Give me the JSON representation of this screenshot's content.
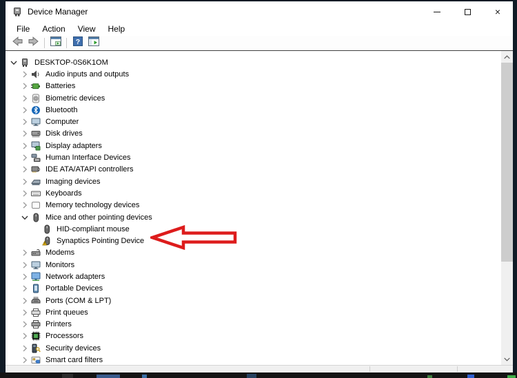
{
  "window": {
    "title": "Device Manager",
    "close_glyph": "×"
  },
  "menu": {
    "items": [
      "File",
      "Action",
      "View",
      "Help"
    ]
  },
  "toolbar": {
    "items": [
      {
        "type": "button",
        "name": "back"
      },
      {
        "type": "button",
        "name": "forward"
      },
      {
        "type": "separator"
      },
      {
        "type": "button",
        "name": "console-tree"
      },
      {
        "type": "separator"
      },
      {
        "type": "button",
        "name": "help"
      },
      {
        "type": "button",
        "name": "action-pane"
      }
    ]
  },
  "tree": {
    "items": [
      {
        "label": "DESKTOP-0S6K1OM",
        "level": 0,
        "state": "expanded",
        "icon": "computer-root-icon"
      },
      {
        "label": "Audio inputs and outputs",
        "level": 1,
        "state": "collapsed",
        "icon": "audio-icon"
      },
      {
        "label": "Batteries",
        "level": 1,
        "state": "collapsed",
        "icon": "battery-icon"
      },
      {
        "label": "Biometric devices",
        "level": 1,
        "state": "collapsed",
        "icon": "fingerprint-icon"
      },
      {
        "label": "Bluetooth",
        "level": 1,
        "state": "collapsed",
        "icon": "bluetooth-icon"
      },
      {
        "label": "Computer",
        "level": 1,
        "state": "collapsed",
        "icon": "monitor-icon"
      },
      {
        "label": "Disk drives",
        "level": 1,
        "state": "collapsed",
        "icon": "disk-icon"
      },
      {
        "label": "Display adapters",
        "level": 1,
        "state": "collapsed",
        "icon": "display-adapter-icon"
      },
      {
        "label": "Human Interface Devices",
        "level": 1,
        "state": "collapsed",
        "icon": "hid-icon"
      },
      {
        "label": "IDE ATA/ATAPI controllers",
        "level": 1,
        "state": "collapsed",
        "icon": "ide-icon"
      },
      {
        "label": "Imaging devices",
        "level": 1,
        "state": "collapsed",
        "icon": "imaging-icon"
      },
      {
        "label": "Keyboards",
        "level": 1,
        "state": "collapsed",
        "icon": "keyboard-icon"
      },
      {
        "label": "Memory technology devices",
        "level": 1,
        "state": "collapsed",
        "icon": "memory-icon"
      },
      {
        "label": "Mice and other pointing devices",
        "level": 1,
        "state": "expanded",
        "icon": "mouse-icon"
      },
      {
        "label": "HID-compliant mouse",
        "level": 2,
        "state": "leaf",
        "icon": "mouse-icon"
      },
      {
        "label": "Synaptics Pointing Device",
        "level": 2,
        "state": "leaf",
        "icon": "mouse-warning-icon"
      },
      {
        "label": "Modems",
        "level": 1,
        "state": "collapsed",
        "icon": "modem-icon"
      },
      {
        "label": "Monitors",
        "level": 1,
        "state": "collapsed",
        "icon": "monitor-icon"
      },
      {
        "label": "Network adapters",
        "level": 1,
        "state": "collapsed",
        "icon": "network-icon"
      },
      {
        "label": "Portable Devices",
        "level": 1,
        "state": "collapsed",
        "icon": "portable-icon"
      },
      {
        "label": "Ports (COM & LPT)",
        "level": 1,
        "state": "collapsed",
        "icon": "ports-icon"
      },
      {
        "label": "Print queues",
        "level": 1,
        "state": "collapsed",
        "icon": "print-queue-icon"
      },
      {
        "label": "Printers",
        "level": 1,
        "state": "collapsed",
        "icon": "printer-icon"
      },
      {
        "label": "Processors",
        "level": 1,
        "state": "collapsed",
        "icon": "processor-icon"
      },
      {
        "label": "Security devices",
        "level": 1,
        "state": "collapsed",
        "icon": "security-icon"
      },
      {
        "label": "Smart card filters",
        "level": 1,
        "state": "collapsed",
        "icon": "smartcard-icon"
      }
    ]
  },
  "annotation": {
    "shape": "block-arrow-left",
    "outline_color": "#dd1c1c",
    "fill_color": "#ffffff",
    "points_at": "Synaptics Pointing Device"
  },
  "colors": {
    "warning_badge": "#f6c21c",
    "desktop_border": "#101b26",
    "scrollbar_thumb": "#cdcdcd"
  }
}
